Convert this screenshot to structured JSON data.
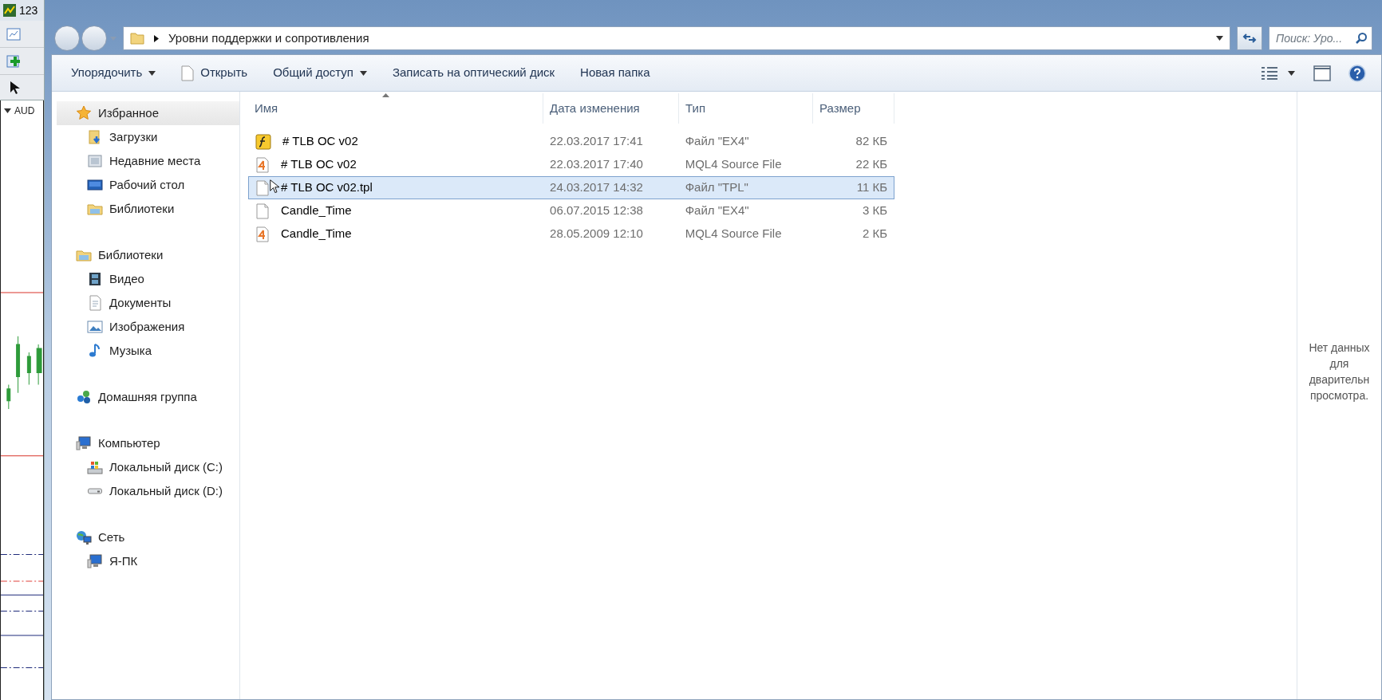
{
  "background_app": {
    "title": "123",
    "symbol": "AUD"
  },
  "address_bar": {
    "path": "Уровни поддержки и сопротивления"
  },
  "search": {
    "placeholder": "Поиск: Уро..."
  },
  "toolbar": [
    {
      "label": "Упорядочить",
      "kind": "dropdown"
    },
    {
      "label": "Открыть",
      "kind": "document"
    },
    {
      "label": "Общий доступ",
      "kind": "dropdown"
    },
    {
      "label": "Записать на оптический диск",
      "kind": "plain"
    },
    {
      "label": "Новая папка",
      "kind": "plain"
    }
  ],
  "navigation": [
    {
      "label": "Избранное",
      "kind": "star",
      "selected": true,
      "children": [
        {
          "label": "Загрузки",
          "kind": "downloads"
        },
        {
          "label": "Недавние места",
          "kind": "recent"
        },
        {
          "label": "Рабочий стол",
          "kind": "desktop"
        },
        {
          "label": "Библиотеки",
          "kind": "library"
        }
      ]
    },
    {
      "label": "Библиотеки",
      "kind": "library",
      "selected": false,
      "children": [
        {
          "label": "Видео",
          "kind": "video"
        },
        {
          "label": "Документы",
          "kind": "document"
        },
        {
          "label": "Изображения",
          "kind": "image"
        },
        {
          "label": "Музыка",
          "kind": "music"
        }
      ]
    },
    {
      "label": "Домашняя группа",
      "kind": "homegroup",
      "selected": false
    },
    {
      "label": "Компьютер",
      "kind": "computer",
      "selected": false,
      "children": [
        {
          "label": "Локальный диск (C:)",
          "kind": "system-drive"
        },
        {
          "label": "Локальный диск (D:)",
          "kind": "drive"
        }
      ]
    },
    {
      "label": "Сеть",
      "kind": "network",
      "selected": false,
      "children": [
        {
          "label": "Я-ПК",
          "kind": "computer"
        }
      ]
    }
  ],
  "table": {
    "columns": [
      "Имя",
      "Дата изменения",
      "Тип",
      "Размер"
    ],
    "rows": [
      {
        "name": "# TLB OC v02",
        "date": "22.03.2017 17:41",
        "type": "Файл \"EX4\"",
        "size": "82 КБ",
        "kind": "ex4",
        "selected": false
      },
      {
        "name": "# TLB OC v02",
        "date": "22.03.2017 17:40",
        "type": "MQL4 Source File",
        "size": "22 КБ",
        "kind": "mq4",
        "selected": false
      },
      {
        "name": "# TLB OC v02.tpl",
        "date": "24.03.2017 14:32",
        "type": "Файл \"TPL\"",
        "size": "11 КБ",
        "kind": "blank",
        "selected": true
      },
      {
        "name": "Candle_Time",
        "date": "06.07.2015 12:38",
        "type": "Файл \"EX4\"",
        "size": "3 КБ",
        "kind": "blank",
        "selected": false
      },
      {
        "name": "Candle_Time",
        "date": "28.05.2009 12:10",
        "type": "MQL4 Source File",
        "size": "2 КБ",
        "kind": "mq4",
        "selected": false
      }
    ]
  },
  "preview_pane": {
    "lines": [
      "Нет данных",
      "для",
      "дварительн",
      "просмотра."
    ]
  }
}
